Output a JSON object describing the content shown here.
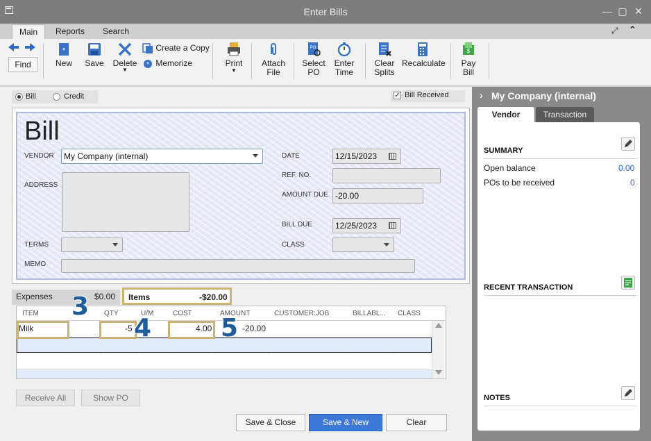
{
  "window": {
    "title": "Enter Bills"
  },
  "ribbon_tabs": [
    "Main",
    "Reports",
    "Search"
  ],
  "toolbar": {
    "find": "Find",
    "new": "New",
    "save": "Save",
    "delete": "Delete",
    "create_copy": "Create a Copy",
    "memorize": "Memorize",
    "print": "Print",
    "attach_file_1": "Attach",
    "attach_file_2": "File",
    "select_po_1": "Select",
    "select_po_2": "PO",
    "enter_time_1": "Enter",
    "enter_time_2": "Time",
    "clear_splits_1": "Clear",
    "clear_splits_2": "Splits",
    "recalculate": "Recalculate",
    "pay_bill_1": "Pay",
    "pay_bill_2": "Bill"
  },
  "type_options": {
    "bill": "Bill",
    "credit": "Credit",
    "selected": "bill"
  },
  "bill_received": {
    "label": "Bill Received",
    "checked": true
  },
  "form": {
    "heading": "Bill",
    "vendor_label": "VENDOR",
    "vendor_value": "My Company (internal)",
    "address_label": "ADDRESS",
    "terms_label": "TERMS",
    "memo_label": "MEMO",
    "date_label": "DATE",
    "date_value": "12/15/2023",
    "ref_label": "REF. NO.",
    "amount_due_label": "AMOUNT DUE",
    "amount_due_value": "-20.00",
    "bill_due_label": "BILL DUE",
    "bill_due_value": "12/25/2023",
    "class_label": "CLASS"
  },
  "subtabs": {
    "expenses_label": "Expenses",
    "expenses_amount": "$0.00",
    "items_label": "Items",
    "items_amount": "-$20.00"
  },
  "items_table": {
    "columns": [
      "ITEM",
      "QTY",
      "U/M",
      "COST",
      "AMOUNT",
      "CUSTOMER:JOB",
      "BILLABL...",
      "CLASS"
    ],
    "rows": [
      {
        "item": "Milk",
        "qty": "-5",
        "um": "",
        "cost": "4.00",
        "amount": "-20.00",
        "customer_job": "",
        "billable": "",
        "class": ""
      }
    ]
  },
  "annotations": [
    "3",
    "4",
    "5"
  ],
  "buttons": {
    "receive_all": "Receive All",
    "show_po": "Show PO",
    "save_close": "Save & Close",
    "save_new": "Save & New",
    "clear": "Clear"
  },
  "right_panel": {
    "company": "My Company (internal)",
    "tab_vendor": "Vendor",
    "tab_transaction": "Transaction",
    "summary_title": "SUMMARY",
    "open_balance_label": "Open balance",
    "open_balance_value": "0.00",
    "pos_label": "POs to be received",
    "pos_value": "0",
    "recent_title": "RECENT TRANSACTION",
    "notes_title": "NOTES"
  },
  "colors": {
    "accent": "#3c78d8",
    "annotation": "#215c9a",
    "highlight": "#c8b274"
  }
}
